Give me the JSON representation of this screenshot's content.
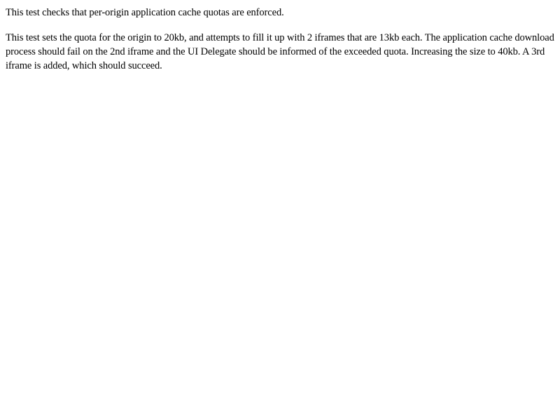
{
  "document": {
    "paragraphs": [
      "This test checks that per-origin application cache quotas are enforced.",
      "This test sets the quota for the origin to 20kb, and attempts to fill it up with 2 iframes that are 13kb each. The application cache download process should fail on the 2nd iframe and the UI Delegate should be informed of the exceeded quota. Increasing the size to 40kb. A 3rd iframe is added, which should succeed."
    ]
  },
  "colors": {
    "background": "#ffffff",
    "text": "#000000"
  }
}
